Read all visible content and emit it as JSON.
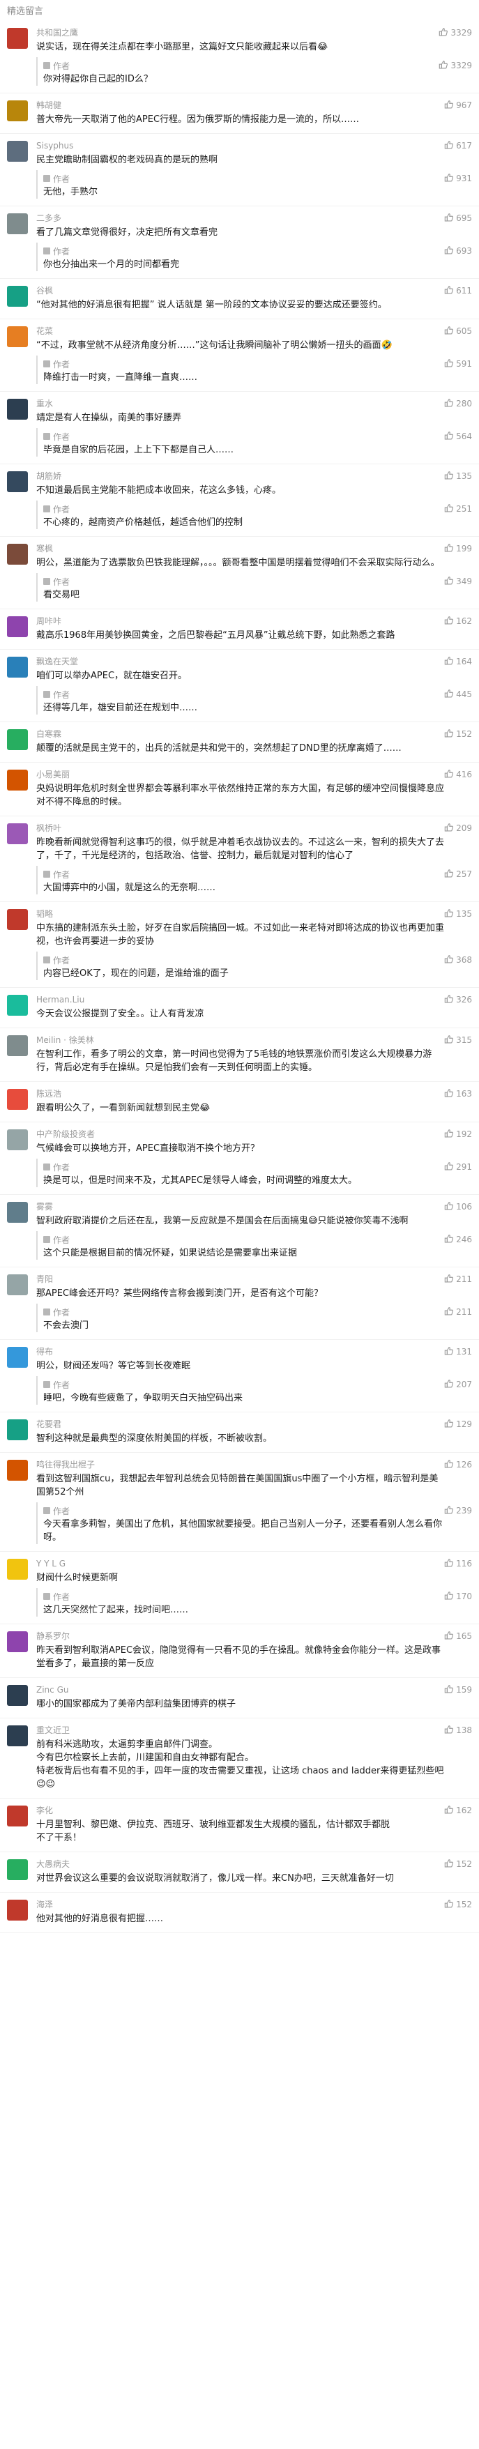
{
  "page": {
    "title": "精选留言"
  },
  "author_label": "作者",
  "comments": [
    {
      "name": "共和国之鹰",
      "likes": "3329",
      "text": "说实话，现在得关注点都在李小璐那里，这篇好文只能收藏起来以后看😂",
      "reply": {
        "likes": "3329",
        "text": "你对得起你自己起的ID么？"
      },
      "avatar_color": "#c0392b"
    },
    {
      "name": "韩胡健",
      "likes": "967",
      "text": "普大帝先一天取消了他的APEC行程。因为俄罗斯的情报能力是一流的，所以……",
      "avatar_color": "#b8860b"
    },
    {
      "name": "Sisyphus",
      "likes": "617",
      "text": "民主党瞻助制固霸权的老戏码真的是玩的熟啊",
      "reply": {
        "likes": "931",
        "text": "无他，手熟尔"
      },
      "avatar_color": "#5d6d7e"
    },
    {
      "name": "二多多",
      "likes": "695",
      "text": "看了几篇文章觉得很好，决定把所有文章看完",
      "reply": {
        "likes": "693",
        "text": "你也分抽出来一个月的时间都看完"
      },
      "avatar_color": "#7f8c8d"
    },
    {
      "name": "谷枫",
      "likes": "611",
      "text": "“他对其他的好消息很有把握” 说人话就是 第一阶段的文本协议妥妥的要达成还要签约。",
      "avatar_color": "#16a085"
    },
    {
      "name": "花菜",
      "likes": "605",
      "text": "“不过，政事堂就不从经济角度分析……”这句话让我瞬间脑补了明公懒娇一扭头的画面🤣",
      "reply": {
        "likes": "591",
        "text": "降维打击一时爽，一直降维一直爽……"
      },
      "avatar_color": "#e67e22"
    },
    {
      "name": "重水",
      "likes": "280",
      "text": "靖定是有人在操纵，南美的事好腰弄",
      "reply": {
        "likes": "564",
        "text": "毕竟是自家的后花园，上上下下都是自己人……"
      },
      "avatar_color": "#2c3e50"
    },
    {
      "name": "胡筋娇",
      "likes": "135",
      "text": "不知道最后民主党能不能把成本收回来，花这么多钱，心疼。",
      "reply": {
        "likes": "251",
        "text": "不心疼的，越南资产价格越低，越适合他们的控制"
      },
      "avatar_color": "#34495e"
    },
    {
      "name": "寒枫",
      "likes": "199",
      "text": "明公，黑道能为了选票散负巴铁我能理解，。。。额哥看整中国是明摆着觉得咱们不会采取实际行动么。",
      "reply": {
        "likes": "349",
        "text": "看交易吧"
      },
      "avatar_color": "#7b4b3a"
    },
    {
      "name": "周咔咔",
      "likes": "162",
      "text": "戴高乐1968年用美钞换回黄金，之后巴黎卷起“五月风暴”让戴总统下野，如此熟悉之套路",
      "avatar_color": "#8e44ad"
    },
    {
      "name": "飘逸在天堂",
      "likes": "164",
      "text": "咱们可以举办APEC，就在雄安召开。",
      "reply": {
        "likes": "445",
        "text": "还得等几年，雄安目前还在规划中……"
      },
      "avatar_color": "#2980b9"
    },
    {
      "name": "白寒霖",
      "likes": "152",
      "text": "颠覆的活就是民主党干的，出兵的活就是共和党干的，突然想起了DND里的抚摩离婚了……",
      "avatar_color": "#27ae60"
    },
    {
      "name": "小易美丽",
      "likes": "416",
      "text": "央妈说明年危机时刻全世界都会等暴利率水平依然维持正常的东方大国，有足够的缓冲空间慢慢降息应对不得不降息的时候。",
      "avatar_color": "#d35400"
    },
    {
      "name": "枫桥叶",
      "likes": "209",
      "text": "昨晚看新闻就觉得智利这事巧的很，似乎就是冲着毛衣战协议去的。不过这么一来，智利的损失大了去了，千了，千光是经济的，包括政治、信誉、控制力，最后就是对智利的信心了",
      "reply": {
        "likes": "257",
        "text": "大国博弈中的小国，就是这么的无奈啊……"
      },
      "avatar_color": "#9b59b6"
    },
    {
      "name": "韬略",
      "likes": "135",
      "text": "中东搞的建制派东头土脸，好歹在自家后院搞回一城。不过如此一来老特对即将达成的协议也再更加重视，也许会再要进一步的妥协",
      "reply": {
        "likes": "368",
        "text": "内容已经OK了，现在的问题，是谁给谁的面子"
      },
      "avatar_color": "#c0392b"
    },
    {
      "name": "Herman.Liu",
      "likes": "326",
      "text": "今天会议公报提到了安全。。让人有背发凉",
      "avatar_color": "#1abc9c"
    },
    {
      "name": "Meilin · 徐美林",
      "likes": "315",
      "text": "在智利工作，看多了明公的文章，第一时间也觉得为了5毛钱的地铁票涨价而引发这么大规模暴力游行，背后必定有手在操纵。只是怕我们会有一天到任何明面上的实锤。",
      "avatar_color": "#7f8c8d"
    },
    {
      "name": "陈远浩",
      "likes": "163",
      "text": "跟看明公久了，一看到新闻就想到民主党😂",
      "avatar_color": "#e74c3c"
    },
    {
      "name": "中产阶级投资者",
      "likes": "192",
      "text": "气候峰会可以换地方开，APEC直接取消不换个地方开？",
      "reply": {
        "likes": "291",
        "text": "换是可以，但是时间来不及，尤其APEC是领导人峰会，时间调整的难度太大。"
      },
      "avatar_color": "#95a5a6"
    },
    {
      "name": "雾雾",
      "likes": "106",
      "text": "智利政府取消提价之后还在乱，我第一反应就是不是国会在后面搞鬼😅只能说被你笑毒不浅啊",
      "reply": {
        "likes": "246",
        "text": "这个只能是根据目前的情况怀疑，如果说结论是需要拿出来证据"
      },
      "avatar_color": "#607d8b"
    },
    {
      "name": "青阳",
      "likes": "211",
      "text": "那APEC峰会还开吗？某些网络传言称会搬到澳门开，是否有这个可能？",
      "reply": {
        "likes": "211",
        "text": "不会去澳门"
      },
      "avatar_color": "#95a5a6"
    },
    {
      "name": "得布",
      "likes": "131",
      "text": "明公，财阀还发吗？等它等到长夜难眠",
      "reply": {
        "likes": "207",
        "text": "睡吧，今晚有些疲惫了，争取明天白天抽空码出来"
      },
      "avatar_color": "#3498db"
    },
    {
      "name": "花要君",
      "likes": "129",
      "text": "智利这种就是最典型的深度依附美国的样板，不断被收割。",
      "avatar_color": "#16a085"
    },
    {
      "name": "鸣往得我出棍子",
      "likes": "126",
      "text": "看到这智利国旗cu，我想起去年智利总统会见特朗普在美国国旗us中圈了一个小方框，暗示智利是美国第52个州",
      "reply": {
        "likes": "239",
        "text": "今天看拿多莉智，美国出了危机，其他国家就要接受。把自己当别人一分子，还要看看别人怎么看你呀。"
      },
      "avatar_color": "#d35400"
    },
    {
      "name": "Y Y L G",
      "likes": "116",
      "text": "财阀什么时候更新啊",
      "reply": {
        "likes": "170",
        "text": "这几天突然忙了起来，找时间吧……"
      },
      "avatar_color": "#f1c40f"
    },
    {
      "name": "静系罗尔",
      "likes": "165",
      "text": "昨天看到智利取消APEC会议，隐隐觉得有一只看不见的手在操乱。就像特金会你能分一样。这是政事堂看多了，最直接的第一反应",
      "avatar_color": "#8e44ad"
    },
    {
      "name": "Zinc Gu",
      "likes": "159",
      "text": "哪小的国家都成为了美帝内部利益集团博弈的棋子",
      "avatar_color": "#2c3e50"
    },
    {
      "name": "重文近卫",
      "likes": "138",
      "text": "前有科米逃助攻，太逼剪李重启邮件门调查。\n今有巴尔检察长上去前，川建国和自由女神都有配合。\n特老板背后也有看不见的手，四年一度的攻击需要又重视，让这场 chaos and ladder来得更猛烈些吧😉😉",
      "avatar_color": "#2c3e50"
    },
    {
      "name": "李化",
      "likes": "162",
      "text": "十月里智利、黎巴嫩、伊拉克、西班牙、玻利维亚都发生大规模的骚乱，估计都双手都脱\n不了干系！",
      "avatar_color": "#c0392b"
    },
    {
      "name": "大愚病夫",
      "likes": "152",
      "text": "对世界会议这么重要的会议说取消就取消了，像儿戏一样。来CN办吧，三天就准备好一切",
      "avatar_color": "#27ae60"
    },
    {
      "name": "海泽",
      "likes": "152",
      "text": "他对其他的好消息很有把握……",
      "avatar_color": "#c0392b"
    }
  ]
}
